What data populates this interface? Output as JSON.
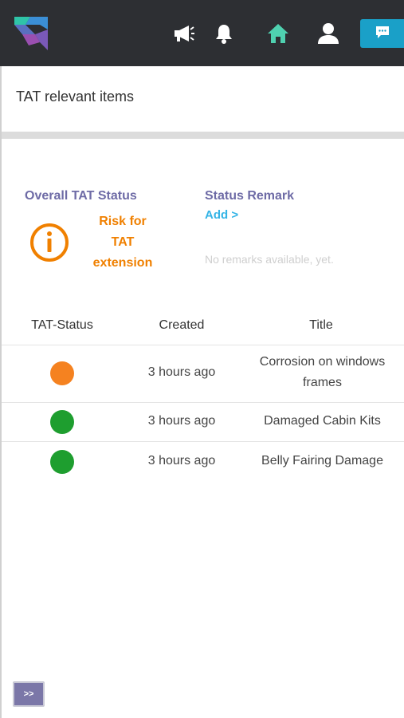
{
  "topbar": {
    "icons": [
      "app-logo",
      "megaphone-icon",
      "bell-icon",
      "home-icon",
      "user-icon",
      "chat-icon"
    ],
    "home_color": "#4fd1b0",
    "chat_bg": "#1aa0c8"
  },
  "page": {
    "title": "TAT relevant items"
  },
  "status": {
    "overall_label": "Overall TAT Status",
    "risk_line1": "Risk for",
    "risk_line2": "TAT",
    "risk_line3": "extension",
    "risk_color": "#f08000",
    "remark_label": "Status Remark",
    "add_label": "Add >",
    "no_remarks": "No remarks available, yet."
  },
  "table": {
    "headers": [
      "TAT-Status",
      "Created",
      "Title"
    ],
    "rows": [
      {
        "status_color": "#f58220",
        "created": "3 hours ago",
        "title_line1": "Corrosion on windows",
        "title_line2": "frames"
      },
      {
        "status_color": "#1e9e2f",
        "created": "3 hours ago",
        "title_line1": "Damaged Cabin Kits",
        "title_line2": ""
      },
      {
        "status_color": "#1e9e2f",
        "created": "3 hours ago",
        "title_line1": "Belly Fairing Damage",
        "title_line2": ""
      }
    ]
  },
  "footer": {
    "expand_label": ">>"
  }
}
